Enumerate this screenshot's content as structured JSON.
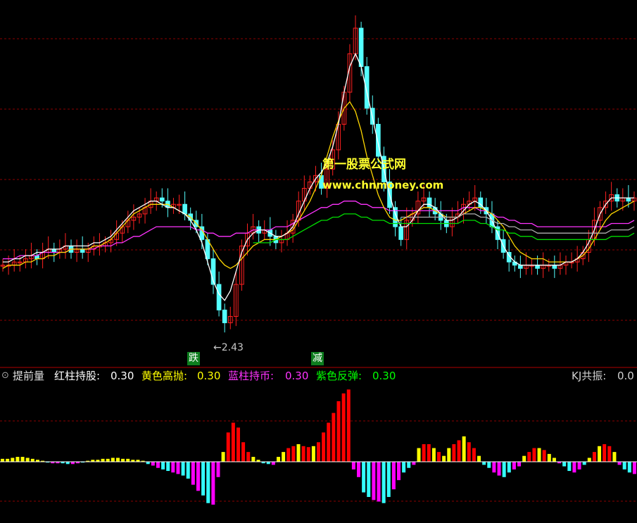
{
  "indicator_bar": {
    "title": "提前量",
    "items": [
      {
        "label": "红柱持股:",
        "value": "0.30",
        "color": "#ffffff"
      },
      {
        "label": "黄色高抛:",
        "value": "0.30",
        "color": "#ffff00"
      },
      {
        "label": "蓝柱持币:",
        "value": "0.30",
        "color": "#ff33ff"
      },
      {
        "label": "紫色反弹:",
        "value": "0.30",
        "color": "#00ff00"
      }
    ],
    "kj_label": "KJ共振:",
    "kj_value": "0.0"
  },
  "watermark": {
    "line1": "第一股票公式网",
    "line2": "www.chnmoney.com"
  },
  "annotations": {
    "low_price": "←2.43",
    "signal_fall": "跌",
    "signal_cut": "减"
  },
  "colors": {
    "up": "#ff2020",
    "down": "#54ffff",
    "grid": "#8b0000",
    "ma_white": "#ffffff",
    "ma_yellow": "#ffd700",
    "ma_magenta": "#ff33ff",
    "ma_green": "#00dd00",
    "ma_gray": "#b0b0b0",
    "hist_red": "#ff0000",
    "hist_yellow": "#ffff00",
    "hist_cyan": "#33ffff",
    "hist_magenta": "#ff00ff"
  },
  "chart_data": [
    {
      "type": "candlestick",
      "title": "",
      "candles_note": "relative price units, 0 = chart bottom, 100 = chart top",
      "close": [
        26,
        26,
        27,
        27,
        28,
        29,
        28,
        30,
        31,
        30,
        31,
        32,
        30,
        31,
        30,
        31,
        32,
        32,
        33,
        34,
        36,
        38,
        40,
        41,
        42,
        44,
        46,
        47,
        46,
        44,
        45,
        45,
        42,
        40,
        38,
        34,
        28,
        20,
        12,
        8,
        10,
        20,
        32,
        36,
        38,
        36,
        37,
        35,
        33,
        34,
        36,
        40,
        46,
        50,
        52,
        54,
        50,
        56,
        62,
        70,
        80,
        92,
        100,
        88,
        75,
        70,
        60,
        52,
        44,
        38,
        34,
        40,
        42,
        46,
        47,
        44,
        42,
        40,
        38,
        41,
        42,
        45,
        46,
        47,
        44,
        42,
        38,
        34,
        30,
        27,
        26,
        25,
        26,
        26,
        25,
        26,
        26,
        25,
        26,
        27,
        27,
        28,
        30,
        34,
        40,
        44,
        46,
        48,
        46,
        47,
        46,
        47
      ],
      "ma_white": [
        27,
        27,
        28,
        28,
        29,
        29,
        30,
        30,
        31,
        31,
        31,
        32,
        32,
        32,
        32,
        32,
        33,
        33,
        34,
        35,
        37,
        39,
        41,
        43,
        44,
        45,
        46,
        46,
        45,
        44,
        44,
        43,
        42,
        40,
        37,
        33,
        27,
        21,
        17,
        15,
        18,
        24,
        30,
        34,
        36,
        37,
        37,
        36,
        35,
        35,
        36,
        38,
        42,
        46,
        50,
        53,
        55,
        58,
        63,
        70,
        80,
        88,
        92,
        88,
        80,
        72,
        64,
        56,
        48,
        42,
        38,
        38,
        40,
        43,
        45,
        45,
        44,
        42,
        40,
        40,
        41,
        43,
        45,
        46,
        45,
        43,
        40,
        36,
        32,
        29,
        27,
        26,
        26,
        26,
        26,
        26,
        26,
        26,
        26,
        27,
        27,
        28,
        30,
        33,
        37,
        42,
        45,
        47,
        47,
        47,
        47,
        47
      ],
      "ma_yellow": [
        25,
        26,
        26,
        26,
        27,
        27,
        28,
        28,
        29,
        29,
        30,
        30,
        31,
        31,
        31,
        31,
        32,
        32,
        33,
        34,
        36,
        38,
        40,
        42,
        43,
        44,
        45,
        45,
        45,
        45,
        44,
        43,
        42,
        41,
        39,
        37,
        34,
        31,
        28,
        26,
        25,
        26,
        28,
        30,
        32,
        33,
        34,
        34,
        34,
        35,
        36,
        37,
        40,
        43,
        46,
        50,
        54,
        60,
        66,
        71,
        75,
        77,
        74,
        68,
        60,
        54,
        48,
        44,
        41,
        40,
        40,
        41,
        42,
        43,
        44,
        44,
        43,
        42,
        41,
        41,
        41,
        42,
        43,
        44,
        44,
        43,
        42,
        40,
        38,
        35,
        32,
        30,
        29,
        28,
        28,
        28,
        27,
        27,
        27,
        27,
        27,
        28,
        29,
        31,
        34,
        37,
        40,
        42,
        43,
        44,
        45,
        46
      ],
      "ma_magenta": [
        28,
        28,
        28,
        29,
        29,
        29,
        29,
        30,
        30,
        30,
        30,
        30,
        31,
        31,
        31,
        31,
        31,
        32,
        32,
        32,
        33,
        33,
        34,
        35,
        35,
        36,
        37,
        38,
        38,
        38,
        38,
        38,
        38,
        38,
        37,
        37,
        36,
        36,
        35,
        35,
        35,
        36,
        36,
        36,
        37,
        37,
        37,
        37,
        38,
        38,
        38,
        39,
        40,
        41,
        42,
        43,
        44,
        44,
        45,
        45,
        46,
        46,
        46,
        45,
        45,
        44,
        44,
        44,
        43,
        43,
        43,
        43,
        43,
        43,
        43,
        43,
        43,
        43,
        43,
        43,
        43,
        44,
        44,
        44,
        43,
        43,
        42,
        41,
        41,
        40,
        40,
        39,
        39,
        39,
        38,
        38,
        38,
        38,
        38,
        38,
        38,
        38,
        38,
        38,
        38,
        38,
        38,
        39,
        39,
        39,
        39,
        40
      ]
    },
    {
      "type": "bar",
      "title": "",
      "values_note": "histogram, positive = above zero line, negative = below",
      "values": [
        3,
        3,
        4,
        5,
        5,
        4,
        3,
        2,
        1,
        -1,
        -2,
        -2,
        -2,
        -3,
        -3,
        -2,
        -1,
        1,
        2,
        2,
        3,
        3,
        4,
        4,
        3,
        3,
        2,
        2,
        1,
        -3,
        -5,
        -8,
        -10,
        -12,
        -14,
        -16,
        -18,
        -22,
        -30,
        -38,
        -44,
        -54,
        -56,
        -20,
        10,
        30,
        40,
        35,
        20,
        10,
        5,
        2,
        -2,
        -3,
        -4,
        5,
        10,
        14,
        16,
        18,
        16,
        15,
        16,
        20,
        30,
        40,
        50,
        62,
        70,
        74,
        -10,
        -20,
        -40,
        -46,
        -50,
        -52,
        -54,
        -46,
        -36,
        -24,
        -14,
        -8,
        -4,
        14,
        18,
        18,
        14,
        10,
        6,
        14,
        18,
        22,
        26,
        20,
        14,
        6,
        -4,
        -8,
        -14,
        -18,
        -20,
        -14,
        -10,
        -6,
        6,
        10,
        14,
        14,
        12,
        8,
        4,
        -2,
        -6,
        -12,
        -14,
        -10,
        -4,
        4,
        10,
        16,
        18,
        16,
        10,
        -4,
        -10,
        -14,
        -16
      ]
    }
  ]
}
